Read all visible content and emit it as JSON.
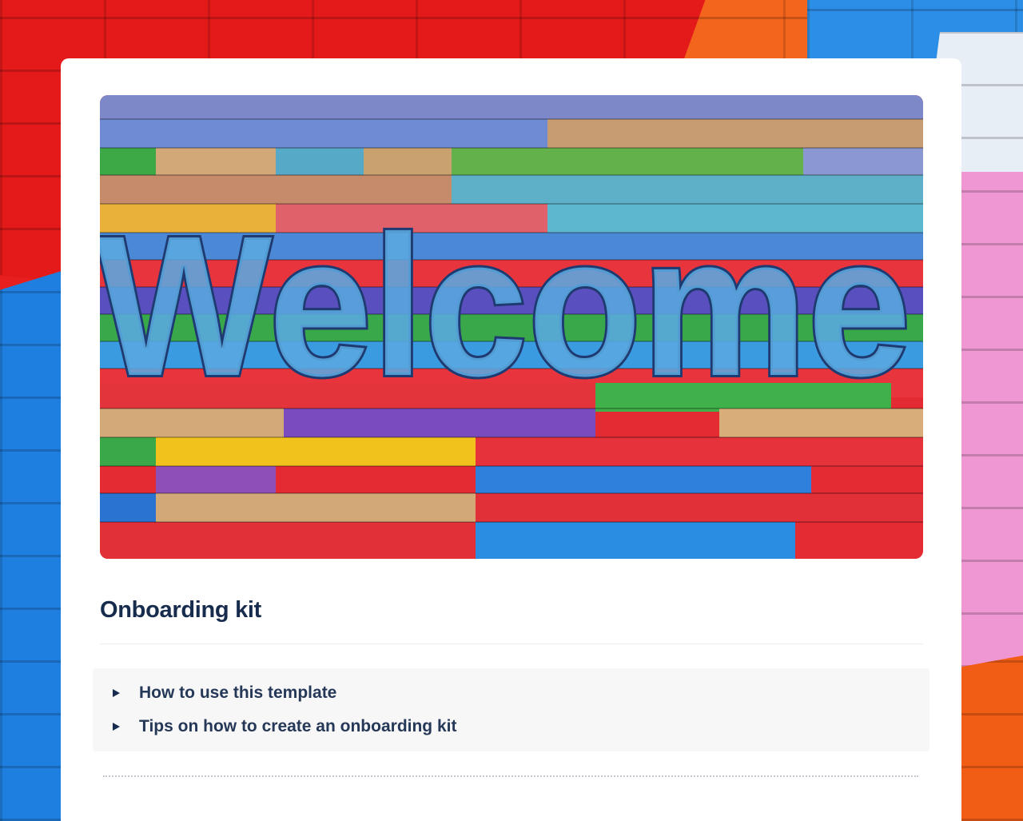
{
  "page": {
    "title": "Onboarding kit",
    "hero_text": "Welcome",
    "expands": [
      {
        "label": "How to use this template"
      },
      {
        "label": "Tips on how to create an onboarding kit"
      }
    ]
  },
  "icons": {
    "expand": "triangle-right-icon"
  },
  "colors": {
    "card": "#ffffff",
    "title": "#172b4d",
    "expand_bg": "#f7f7f7",
    "mural_red": "#e41a1a",
    "mural_blue": "#1f7fe0",
    "mural_pink": "#ef97d3",
    "mural_orange": "#f25d16"
  }
}
